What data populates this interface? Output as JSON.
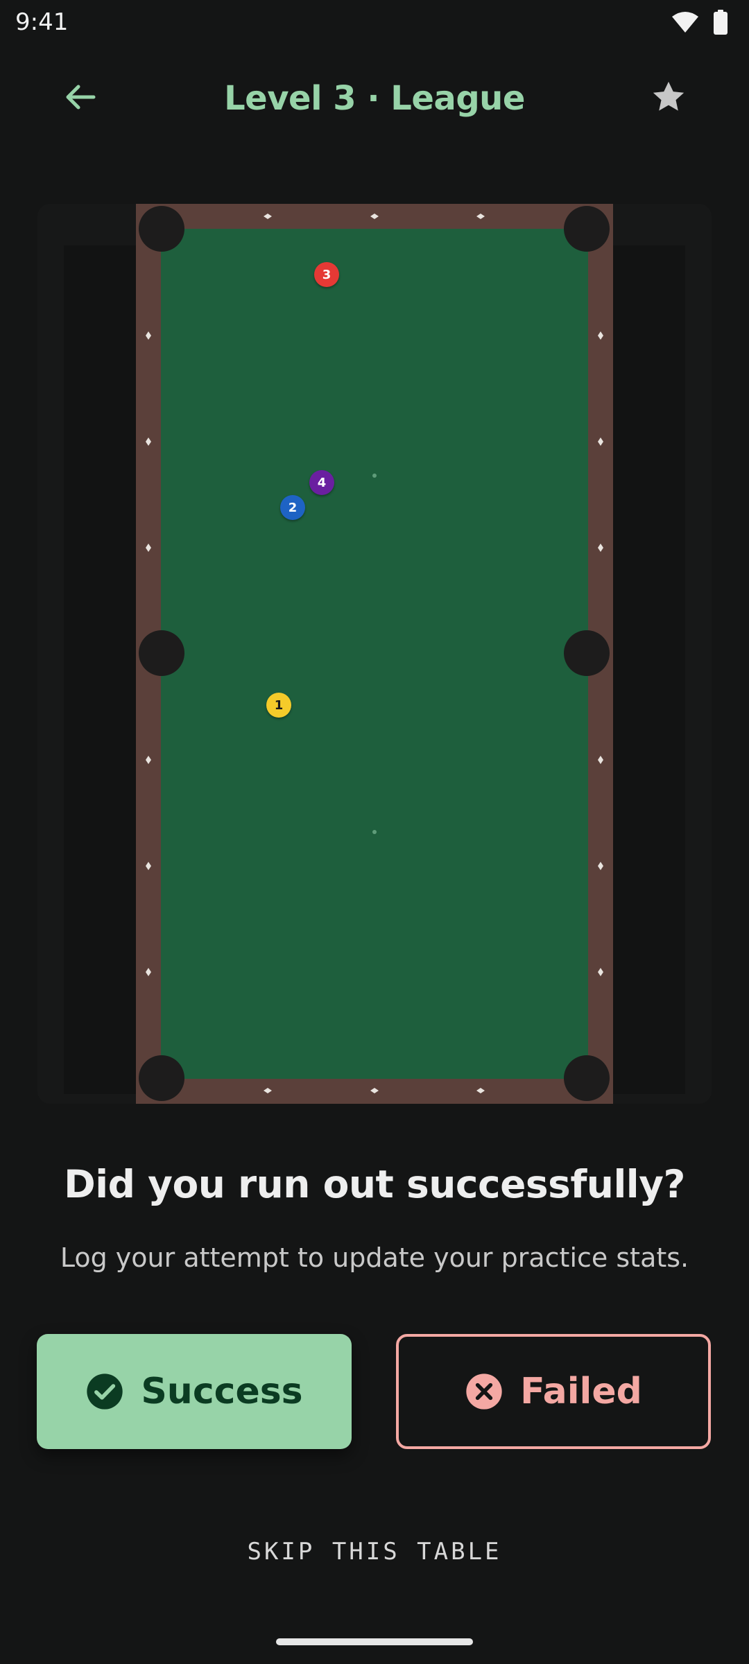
{
  "status_bar": {
    "time": "9:41",
    "icons": [
      "wifi-icon",
      "battery-icon"
    ]
  },
  "app_bar": {
    "title": "Level 3 · League",
    "back_icon": "arrow-left-icon",
    "favorite_icon": "star-icon"
  },
  "table": {
    "balls": [
      {
        "number": "3",
        "color": "#e53935",
        "text_color": "#ffffff"
      },
      {
        "number": "4",
        "color": "#6a1fa0",
        "text_color": "#ffffff"
      },
      {
        "number": "2",
        "color": "#1e63c4",
        "text_color": "#ffffff"
      },
      {
        "number": "1",
        "color": "#f5cb2a",
        "text_color": "#1a1a1a"
      }
    ]
  },
  "prompt": {
    "question": "Did you run out successfully?",
    "subtext": "Log your attempt to update your practice stats."
  },
  "actions": {
    "success_label": "Success",
    "success_icon": "check-circle-icon",
    "failed_label": "Failed",
    "failed_icon": "x-circle-icon",
    "skip_label": "SKIP THIS TABLE"
  },
  "colors": {
    "accent": "#97d3a8",
    "failed": "#f4a8a3",
    "felt": "#1e5f3d",
    "rail": "#5b403a",
    "background": "#141515"
  }
}
